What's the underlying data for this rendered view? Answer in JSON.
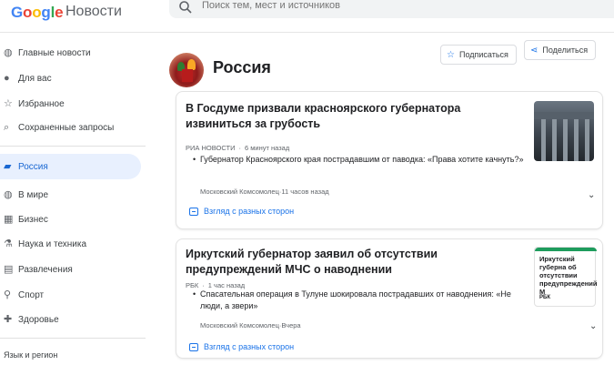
{
  "app": {
    "logo_word": "Google",
    "logo_suffix": "Новости"
  },
  "search": {
    "placeholder": "Поиск тем, мест и источников"
  },
  "sidebar": {
    "items": [
      {
        "label": "Главные новости",
        "icon": "globe-icon"
      },
      {
        "label": "Для вас",
        "icon": "person-icon"
      },
      {
        "label": "Избранное",
        "icon": "star-icon"
      },
      {
        "label": "Сохраненные запросы",
        "icon": "search-icon"
      },
      {
        "label": "Россия",
        "icon": "flag-icon",
        "active": true
      },
      {
        "label": "В мире",
        "icon": "globe-icon"
      },
      {
        "label": "Бизнес",
        "icon": "building-icon"
      },
      {
        "label": "Наука и техника",
        "icon": "flask-icon"
      },
      {
        "label": "Развлечения",
        "icon": "film-icon"
      },
      {
        "label": "Спорт",
        "icon": "bike-icon"
      },
      {
        "label": "Здоровье",
        "icon": "health-icon"
      }
    ],
    "footer_label": "Язык и регион"
  },
  "header": {
    "title": "Россия",
    "subscribe_label": "Подписаться",
    "share_label": "Поделиться"
  },
  "stories": [
    {
      "title": "В Госдуме призвали красноярского губернатора извиниться за грубость",
      "source": "РИА НОВОСТИ",
      "time": "6 минут назад",
      "sub_title": "Губернатор Красноярского края пострадавшим от паводка: «Права хотите качнуть?»",
      "sub_source": "Московский Комсомолец",
      "sub_time": "11 часов назад",
      "perspectives_label": "Взгляд с разных сторон"
    },
    {
      "title": "Иркутский губернатор заявил об отсутствии предупреждений МЧС о наводнении",
      "source": "РБК",
      "time": "1 час назад",
      "sub_title": "Спасательная операция в Тулуне шокировала пострадавших от наводнения: «Не люди, а звери»",
      "sub_source": "Московский Комсомолец",
      "sub_time": "Вчера",
      "perspectives_label": "Взгляд с разных сторон",
      "thumb_text": "Иркутский губерна об отсутствии предупреждений М",
      "thumb_brand": "РБК"
    }
  ],
  "colors": {
    "accent": "#1a73e8",
    "active_bg": "#e8f0fe"
  }
}
